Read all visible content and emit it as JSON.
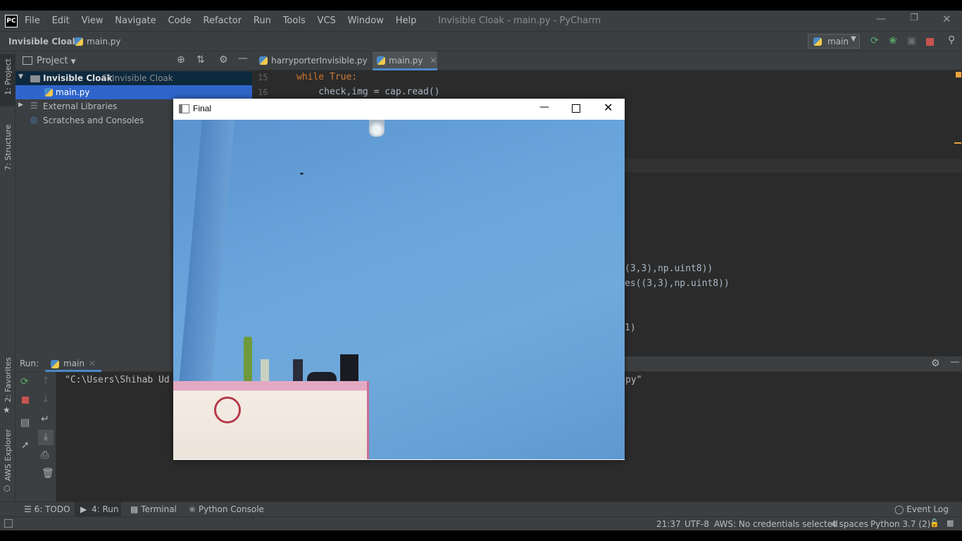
{
  "app": {
    "logo": "PC",
    "menu": [
      "File",
      "Edit",
      "View",
      "Navigate",
      "Code",
      "Refactor",
      "Run",
      "Tools",
      "VCS",
      "Window",
      "Help"
    ],
    "window_title": "Invisible Cloak - main.py - PyCharm"
  },
  "nav": {
    "project": "Invisible Cloak",
    "file": "main.py",
    "run_config": "main"
  },
  "left_strip": {
    "project": "1: Project",
    "structure": "7: Structure",
    "favorites": "2: Favorites",
    "aws": "AWS Explorer"
  },
  "project_panel": {
    "title": "Project",
    "root_name": "Invisible Cloak",
    "root_path": "F:\\Invisible Cloak",
    "file": "main.py",
    "ext_libs": "External Libraries",
    "scratches": "Scratches and Consoles"
  },
  "editor": {
    "tabs": [
      "harryporterInvisible.py",
      "main.py"
    ],
    "line15_no": "15",
    "line15": "while True:",
    "line16_no": "16",
    "line16": "    check,img = cap.read()",
    "frag1": "(3,3),np.uint8))",
    "frag2": "es((3,3),np.uint8))",
    "frag3": "1)"
  },
  "run": {
    "label": "Run:",
    "tab": "main",
    "output_start": "\"C:\\Users\\Shihab Ud",
    "output_end": "py\""
  },
  "final_window": {
    "title": "Final"
  },
  "bottom_tabs": {
    "todo": "6: TODO",
    "run": "4: Run",
    "terminal": "Terminal",
    "console": "Python Console",
    "event_log": "Event Log"
  },
  "status": {
    "position": "21:37",
    "encoding": "UTF-8",
    "aws": "AWS: No credentials selected",
    "indent": "4 spaces",
    "interpreter": "Python 3.7 (2)"
  },
  "colors": {
    "keyword": "#cc7832",
    "number": "#6897bb",
    "accent": "#4a88c7"
  }
}
